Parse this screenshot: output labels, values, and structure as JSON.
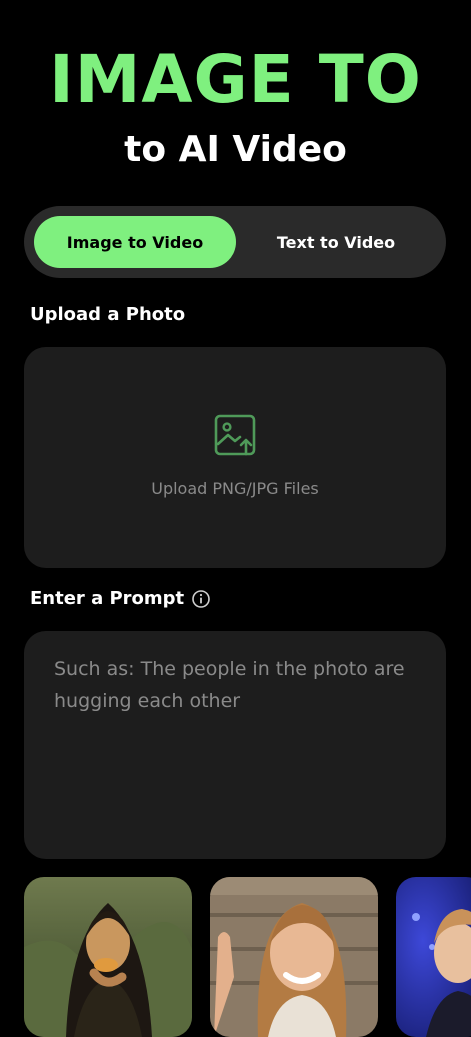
{
  "header": {
    "title": "IMAGE TO",
    "subtitle": "to AI Video"
  },
  "tabs": {
    "items": [
      {
        "label": "Image to Video",
        "active": true
      },
      {
        "label": "Text to Video",
        "active": false
      }
    ]
  },
  "upload": {
    "section_label": "Upload a Photo",
    "icon": "image-upload-icon",
    "hint": "Upload PNG/JPG Files"
  },
  "prompt": {
    "section_label": "Enter a Prompt",
    "info_icon": "info-icon",
    "placeholder": "Such as: The people in the photo are hugging each other",
    "value": ""
  },
  "examples": {
    "items": [
      {
        "name": "mona-lisa-eating-example"
      },
      {
        "name": "girl-waving-example"
      },
      {
        "name": "boy-stage-example"
      }
    ]
  },
  "colors": {
    "background": "#000000",
    "accent": "#7ff07f",
    "panel": "#1d1d1d",
    "tab_track": "#2a2a2a",
    "muted_text": "#8a8a8a",
    "icon_green": "#4f9a59"
  }
}
